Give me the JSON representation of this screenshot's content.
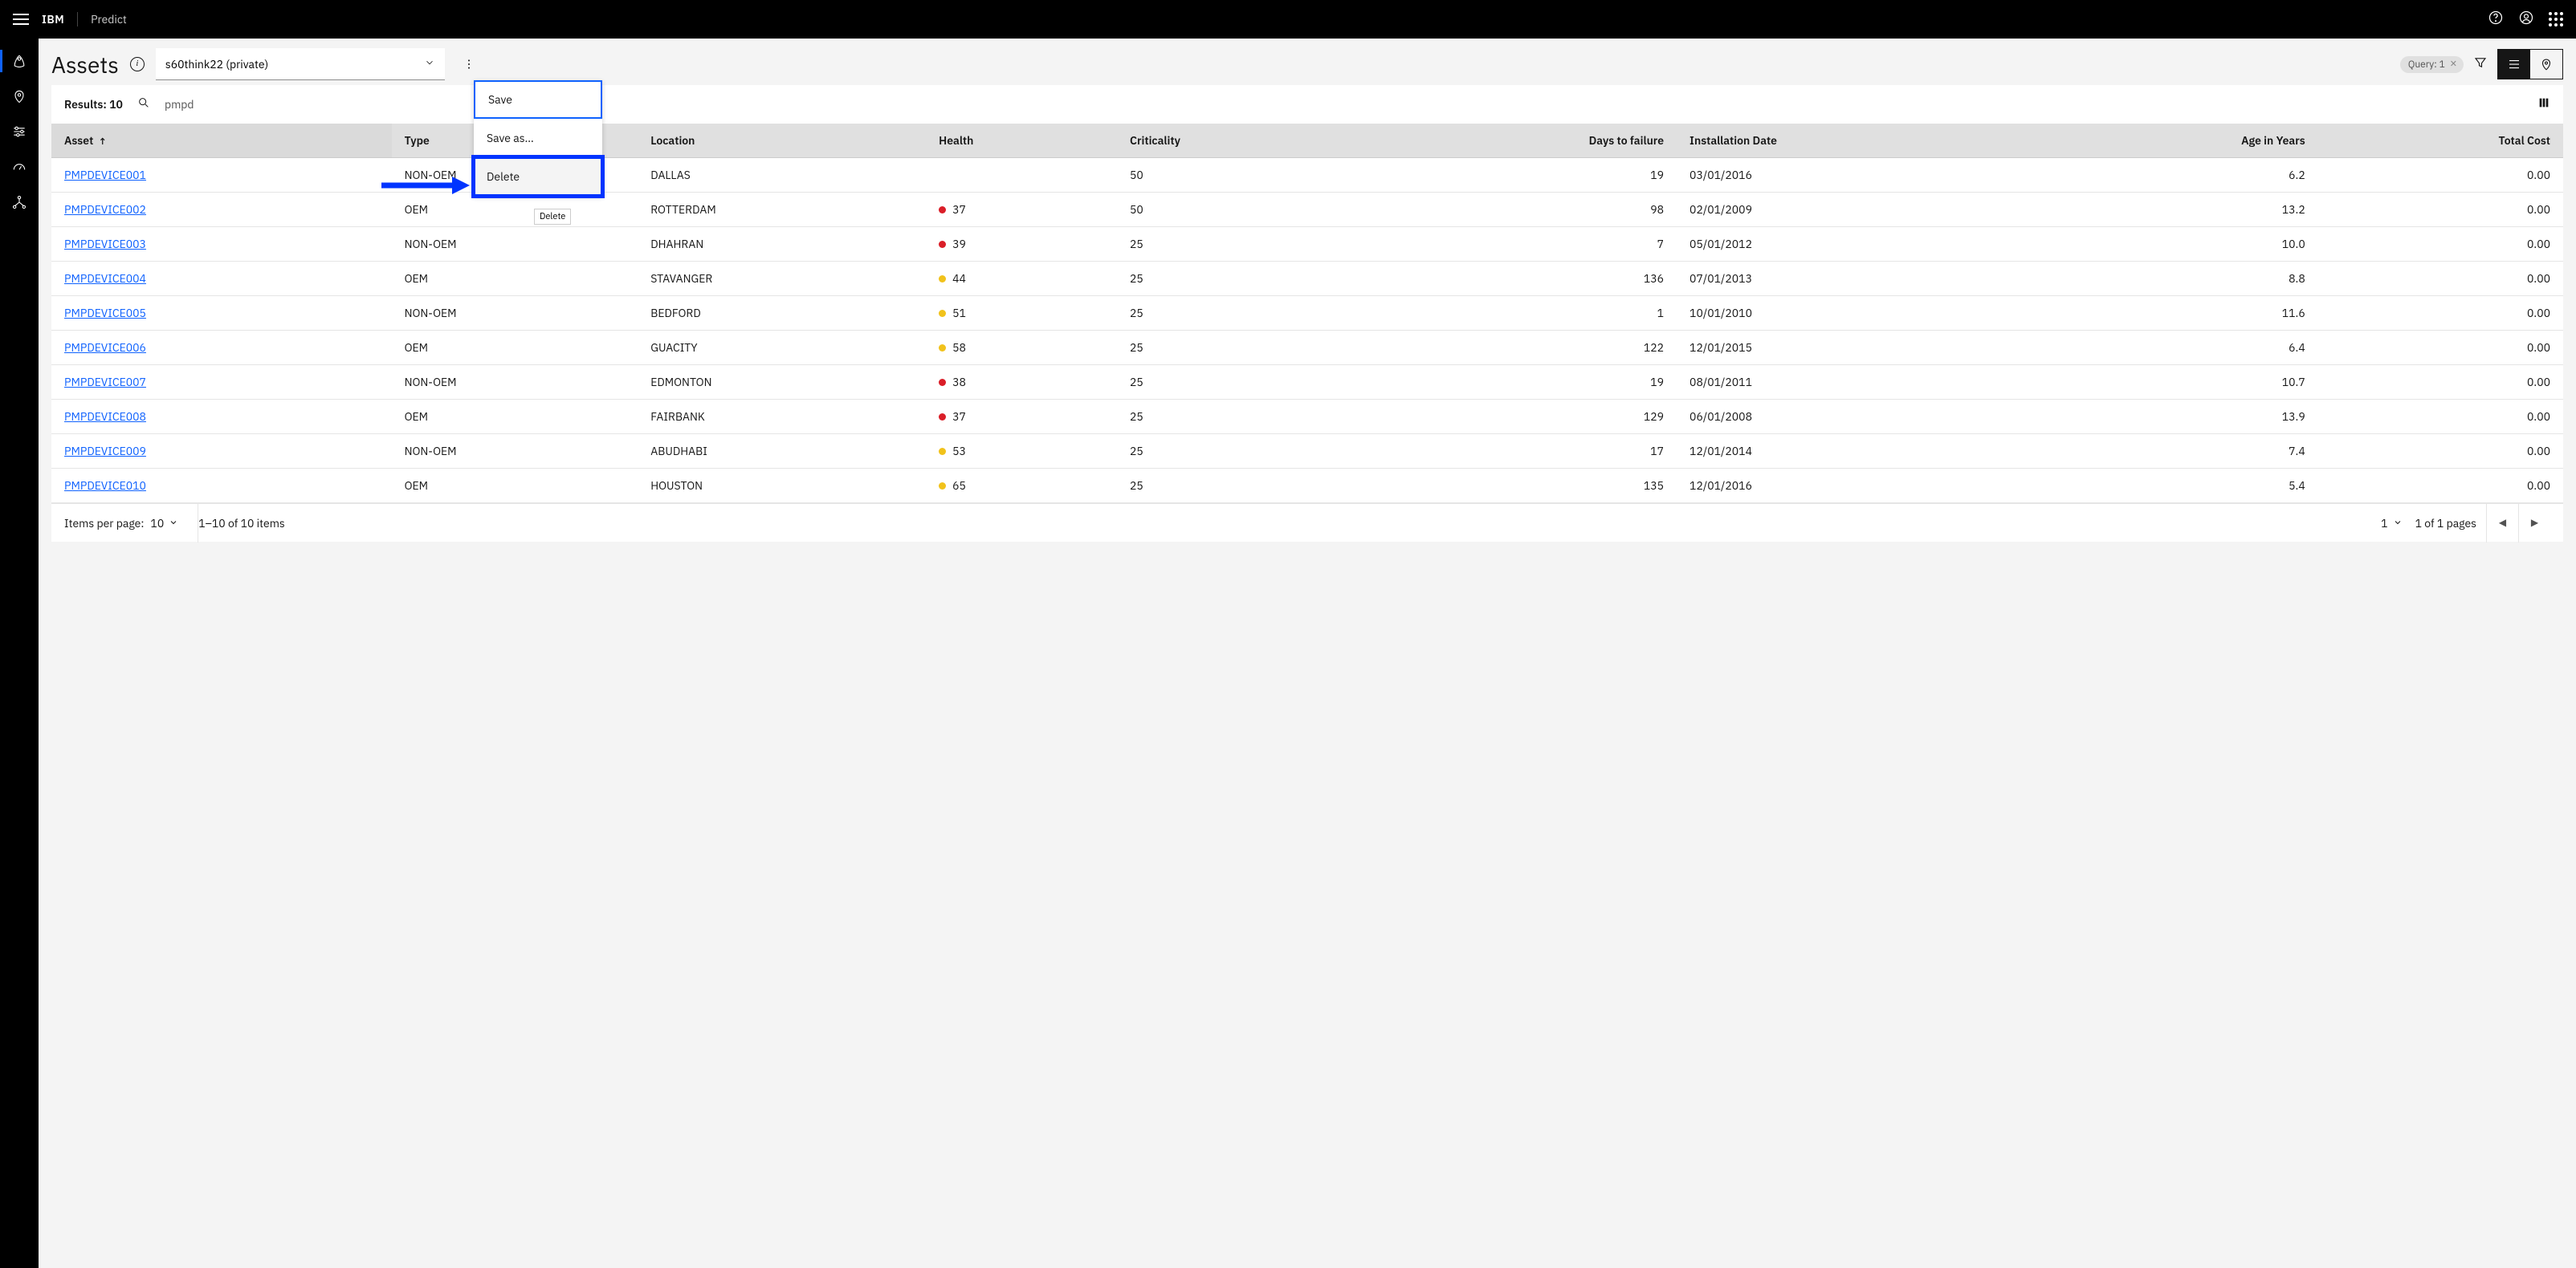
{
  "brand": "IBM",
  "app_name": "Predict",
  "page_title": "Assets",
  "query_name": "s60think22 (private)",
  "overflow_menu": {
    "save": "Save",
    "save_as": "Save as…",
    "delete": "Delete",
    "tooltip": "Delete"
  },
  "query_pill": {
    "label": "Query: 1"
  },
  "search": {
    "results_label": "Results: 10",
    "value": "pmpd"
  },
  "columns": {
    "asset": "Asset",
    "type": "Type",
    "location": "Location",
    "health": "Health",
    "criticality": "Criticality",
    "days_to_failure": "Days to failure",
    "installation_date": "Installation Date",
    "age_in_years": "Age in Years",
    "total_cost": "Total Cost"
  },
  "rows": [
    {
      "asset": "PMPDEVICE001",
      "type": "NON-OEM",
      "location": "DALLAS",
      "health": "",
      "health_color": "",
      "criticality": "50",
      "days": "19",
      "install": "03/01/2016",
      "age": "6.2",
      "cost": "0.00"
    },
    {
      "asset": "PMPDEVICE002",
      "type": "OEM",
      "location": "ROTTERDAM",
      "health": "37",
      "health_color": "red",
      "criticality": "50",
      "days": "98",
      "install": "02/01/2009",
      "age": "13.2",
      "cost": "0.00"
    },
    {
      "asset": "PMPDEVICE003",
      "type": "NON-OEM",
      "location": "DHAHRAN",
      "health": "39",
      "health_color": "red",
      "criticality": "25",
      "days": "7",
      "install": "05/01/2012",
      "age": "10.0",
      "cost": "0.00"
    },
    {
      "asset": "PMPDEVICE004",
      "type": "OEM",
      "location": "STAVANGER",
      "health": "44",
      "health_color": "yellow",
      "criticality": "25",
      "days": "136",
      "install": "07/01/2013",
      "age": "8.8",
      "cost": "0.00"
    },
    {
      "asset": "PMPDEVICE005",
      "type": "NON-OEM",
      "location": "BEDFORD",
      "health": "51",
      "health_color": "yellow",
      "criticality": "25",
      "days": "1",
      "install": "10/01/2010",
      "age": "11.6",
      "cost": "0.00"
    },
    {
      "asset": "PMPDEVICE006",
      "type": "OEM",
      "location": "GUACITY",
      "health": "58",
      "health_color": "yellow",
      "criticality": "25",
      "days": "122",
      "install": "12/01/2015",
      "age": "6.4",
      "cost": "0.00"
    },
    {
      "asset": "PMPDEVICE007",
      "type": "NON-OEM",
      "location": "EDMONTON",
      "health": "38",
      "health_color": "red",
      "criticality": "25",
      "days": "19",
      "install": "08/01/2011",
      "age": "10.7",
      "cost": "0.00"
    },
    {
      "asset": "PMPDEVICE008",
      "type": "OEM",
      "location": "FAIRBANK",
      "health": "37",
      "health_color": "red",
      "criticality": "25",
      "days": "129",
      "install": "06/01/2008",
      "age": "13.9",
      "cost": "0.00"
    },
    {
      "asset": "PMPDEVICE009",
      "type": "NON-OEM",
      "location": "ABUDHABI",
      "health": "53",
      "health_color": "yellow",
      "criticality": "25",
      "days": "17",
      "install": "12/01/2014",
      "age": "7.4",
      "cost": "0.00"
    },
    {
      "asset": "PMPDEVICE010",
      "type": "OEM",
      "location": "HOUSTON",
      "health": "65",
      "health_color": "yellow",
      "criticality": "25",
      "days": "135",
      "install": "12/01/2016",
      "age": "5.4",
      "cost": "0.00"
    }
  ],
  "pagination": {
    "items_per_page_label": "Items per page:",
    "items_per_page": "10",
    "range": "1–10 of 10 items",
    "page": "1",
    "page_of": "1 of 1 pages"
  }
}
